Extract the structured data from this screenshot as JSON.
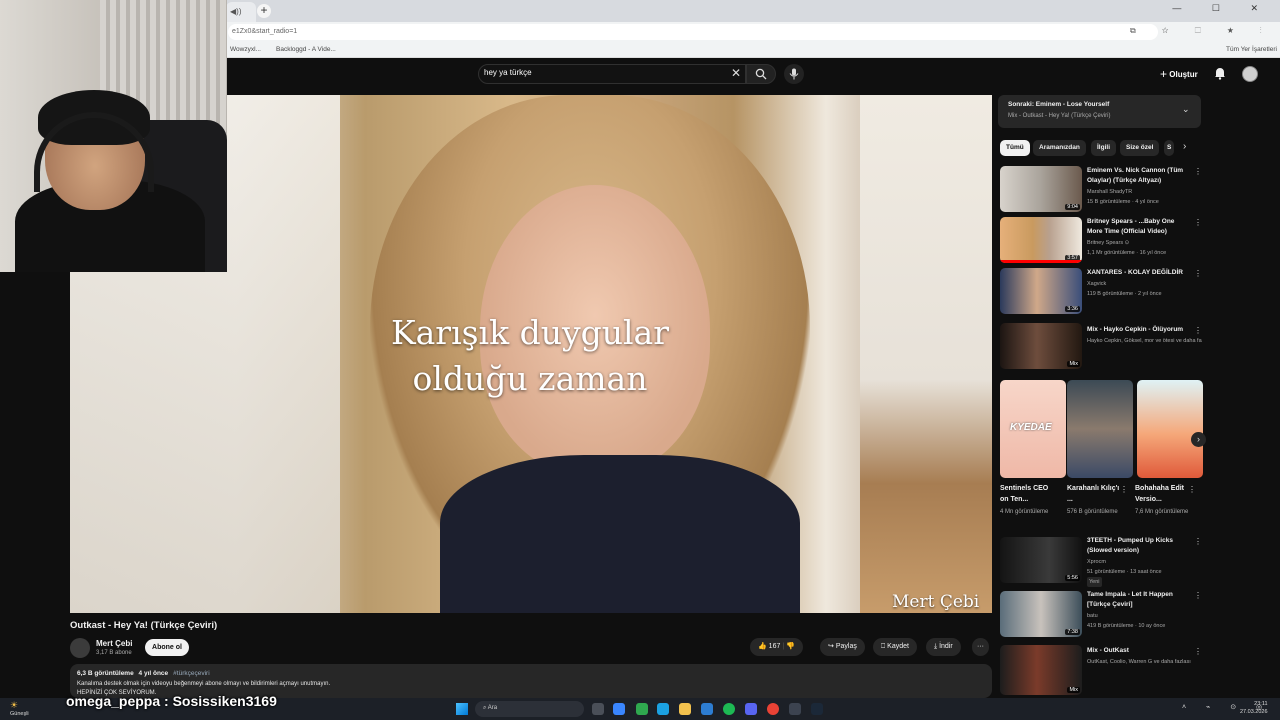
{
  "browser": {
    "address": "e1Zx0&start_radio=1",
    "bookmarks": [
      "Wowzyxl...",
      "Backloggd - A Vide...",
      "Tüm Yer İşaretleri"
    ]
  },
  "youtube": {
    "search_query": "hey ya türkçe",
    "create_label": "Oluştur"
  },
  "video": {
    "caption_line1": "Karışık duygular",
    "caption_line2": "olduğu zaman",
    "watermark": "Mert Çebi",
    "title": "Outkast - Hey Ya! (Türkçe Çeviri)",
    "channel_name": "Mert Çebi",
    "channel_subs": "3,17 B abone",
    "subscribe_label": "Abone ol",
    "likes": "167",
    "share_label": "Paylaş",
    "save_label": "Kaydet",
    "download_label": "İndir",
    "more_label": "···",
    "description": {
      "views": "6,3 B görüntüleme",
      "age": "4 yıl önce",
      "tag": "#türkçeçeviri",
      "line1": "Kanalıma destek olmak için videoyu beğenmeyi abone olmayı ve bildirimleri açmayı unutmayın.",
      "line2": "HEPİNİZİ ÇOK SEVİYORUM."
    }
  },
  "sidebar": {
    "up_next_title": "Sonraki: Eminem - Lose Yourself",
    "up_next_sub": "Mix - Outkast - Hey Ya! (Türkçe Çeviri)",
    "chips": [
      "Tümü",
      "Aramanızdan",
      "İlgili",
      "Size özel",
      "S"
    ],
    "recs": [
      {
        "title": "Eminem Vs. Nick Cannon (Tüm Olaylar) (Türkçe Altyazı)",
        "channel": "Marshall ShadyTR",
        "meta": "15 B görüntüleme · 4 yıl önce",
        "duration": "9:04"
      },
      {
        "title": "Britney Spears - ...Baby One More Time (Official Video)",
        "channel": "Britney Spears ⊙",
        "meta": "1,1 Mr görüntüleme · 16 yıl önce",
        "duration": "3:57"
      },
      {
        "title": "XANTARES - KOLAY DEĞİLDİR",
        "channel": "Xagvick",
        "meta": "119 B görüntüleme · 2 yıl önce",
        "duration": "3:36"
      },
      {
        "title": "Mix - Hayko Cepkin - Ölüyorum",
        "channel": "Hayko Cepkin, Göksel, mor ve ötesi ve daha fazlası",
        "meta": "",
        "duration": "Mix"
      }
    ],
    "shorts": [
      {
        "title": "Sentinels CEO on Ten...",
        "views": "4 Mn görüntüleme",
        "overlay": "KYEDAE"
      },
      {
        "title": "Karahanlı Kılıç'ı ...",
        "views": "576 B görüntüleme",
        "overlay": ""
      },
      {
        "title": "Bohahaha Edit Versio...",
        "views": "7,6 Mn görüntüleme",
        "overlay": ""
      }
    ],
    "recs2": [
      {
        "title": "3TEETH - Pumped Up Kicks (Slowed version)",
        "channel": "Xprocm",
        "meta": "51 görüntüleme · 13 saat önce",
        "badge": "Yeni",
        "duration": "5:56"
      },
      {
        "title": "Tame Impala - Let It Happen [Türkçe Çeviri]",
        "channel": "batu",
        "meta": "419 B görüntüleme · 10 ay önce",
        "duration": "7:38"
      },
      {
        "title": "Mix - OutKast",
        "channel": "OutKast, Coolio, Warren G ve daha fazlası",
        "meta": "",
        "duration": "Mix"
      }
    ]
  },
  "taskbar": {
    "weather": "Güneşli",
    "chat": "omega_peppa : Sosissiken3169",
    "search": "Ara",
    "time": "23:11",
    "date": "27.03.2026"
  },
  "colors": {
    "accent": "#ff0000",
    "bg": "#0f0f0f",
    "chip_active": "#f1f1f1"
  }
}
